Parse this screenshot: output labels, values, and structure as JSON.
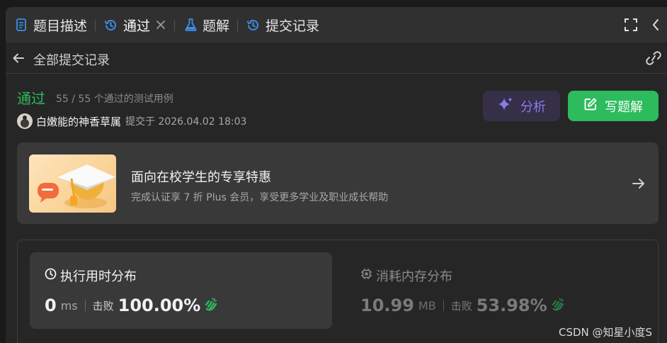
{
  "tabs": {
    "description": "题目描述",
    "accepted": "通过",
    "solutions": "题解",
    "submissions": "提交记录"
  },
  "subheader": {
    "back_label": "全部提交记录"
  },
  "result": {
    "status": "通过",
    "testcases": "55 / 55 个通过的测试用例",
    "username": "白嫩能的神香草属",
    "submitted_at": "提交于 2026.04.02 18:03"
  },
  "actions": {
    "analyze_label": "分析",
    "write_solution_label": "写题解"
  },
  "promo": {
    "title": "面向在校学生的专享特惠",
    "subtitle": "完成认证享 7 折 Plus 会员，享受更多学业及职业成长帮助"
  },
  "runtime": {
    "title": "执行用时分布",
    "value": "0",
    "unit": "ms",
    "beats_label": "击败",
    "beats": "100.00%"
  },
  "memory": {
    "title": "消耗内存分布",
    "value": "10.99",
    "unit": "MB",
    "beats_label": "击败",
    "beats": "53.98%"
  },
  "watermark": "CSDN @知星小度S",
  "colors": {
    "accent_green": "#2cbb5d",
    "analyze_purple": "#8a7cf0",
    "tab_blue": "#3a8eea"
  }
}
